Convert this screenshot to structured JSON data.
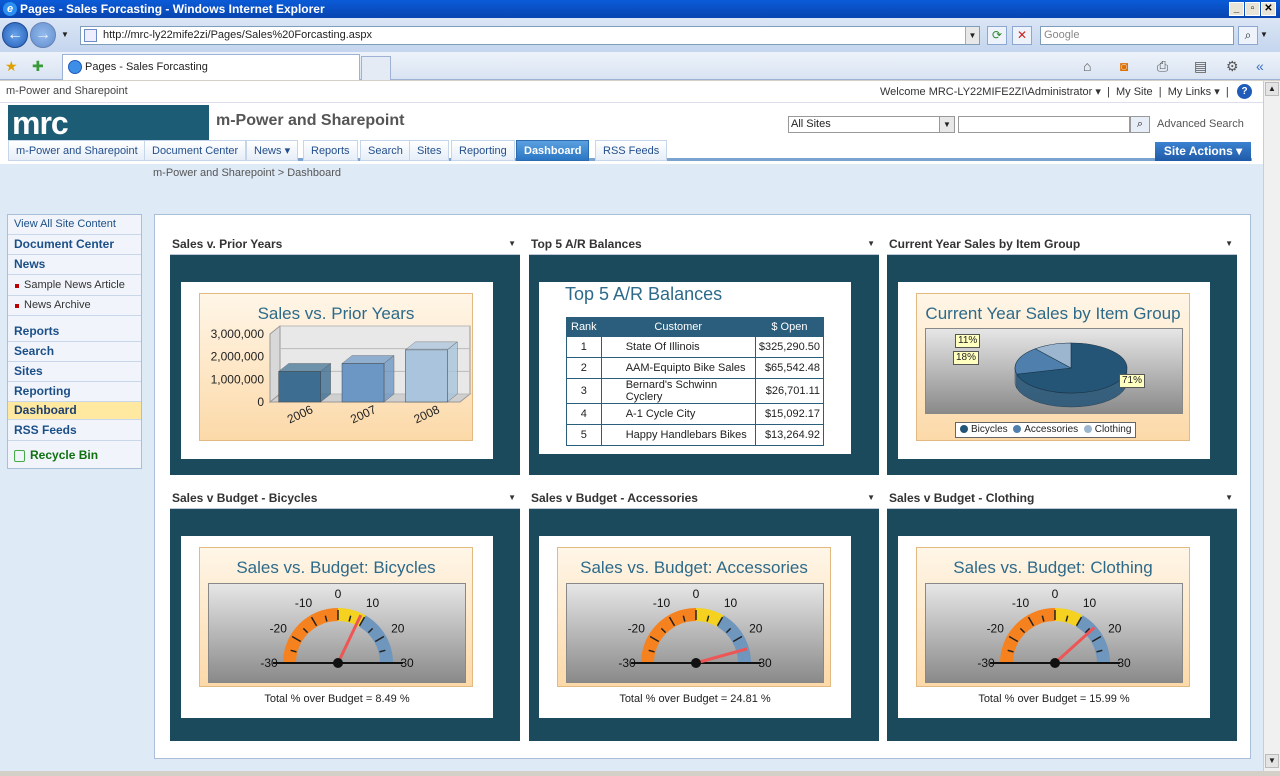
{
  "browser": {
    "window_title": "Pages - Sales Forcasting - Windows Internet Explorer",
    "url": "http://mrc-ly22mife2zi/Pages/Sales%20Forcasting.aspx",
    "search_placeholder": "Google",
    "tab_title": "Pages - Sales Forcasting"
  },
  "sp": {
    "site_link": "m-Power and Sharepoint",
    "welcome": "Welcome MRC-LY22MIFE2ZI\\Administrator",
    "my_site": "My Site",
    "my_links": "My Links",
    "logo": "mrc",
    "site_title": "m-Power and Sharepoint",
    "search_scope": "All Sites",
    "advanced_search": "Advanced Search",
    "site_actions": "Site Actions",
    "nav": [
      "m-Power and Sharepoint",
      "Document Center",
      "News",
      "Reports",
      "Search",
      "Sites",
      "Reporting",
      "Dashboard",
      "RSS Feeds"
    ],
    "breadcrumb": "m-Power and Sharepoint > Dashboard"
  },
  "quicklaunch": {
    "view_all": "View All Site Content",
    "document_center": "Document Center",
    "news": "News",
    "news_items": [
      "Sample News Article",
      "News Archive"
    ],
    "reports": "Reports",
    "search": "Search",
    "sites": "Sites",
    "reporting": "Reporting",
    "dashboard": "Dashboard",
    "rss": "RSS Feeds",
    "recycle": "Recycle Bin"
  },
  "webparts": {
    "wp1_title": "Sales v. Prior Years",
    "wp2_title": "Top 5 A/R Balances",
    "wp3_title": "Current Year Sales by Item Group",
    "wp4_title": "Sales v Budget - Bicycles",
    "wp5_title": "Sales v Budget - Accessories",
    "wp6_title": "Sales v Budget - Clothing"
  },
  "ar_table": {
    "title": "Top 5 A/R Balances",
    "headers": [
      "Rank",
      "Customer",
      "$ Open"
    ],
    "rows": [
      [
        "1",
        "State Of Illinois",
        "$325,290.50"
      ],
      [
        "2",
        "AAM-Equipto Bike Sales",
        "$65,542.48"
      ],
      [
        "3",
        "Bernard's Schwinn Cyclery",
        "$26,701.11"
      ],
      [
        "4",
        "A-1 Cycle City",
        "$15,092.17"
      ],
      [
        "5",
        "Happy Handlebars Bikes",
        "$13,264.92"
      ]
    ]
  },
  "chart_data": [
    {
      "type": "bar",
      "title": "Sales vs. Prior Years",
      "categories": [
        "2006",
        "2007",
        "2008"
      ],
      "values": [
        1350000,
        1700000,
        2300000
      ],
      "ylim": [
        0,
        3000000
      ],
      "yticks": [
        "3,000,000",
        "2,000,000",
        "1,000,000",
        "0"
      ],
      "colors": [
        "#3d6e92",
        "#6c97c4",
        "#a9c4dc"
      ]
    },
    {
      "type": "pie",
      "title": "Current Year Sales by Item Group",
      "categories": [
        "Bicycles",
        "Accessories",
        "Clothing"
      ],
      "values": [
        71,
        18,
        11
      ],
      "labels": [
        "71%",
        "18%",
        "11%"
      ],
      "colors": [
        "#245577",
        "#4f80ad",
        "#9bb6ce"
      ]
    },
    {
      "type": "gauge",
      "title": "Sales vs. Budget: Bicycles",
      "value": 8.49,
      "range": [
        -30,
        30
      ],
      "ticks": [
        "-30",
        "-20",
        "-10",
        "0",
        "10",
        "20",
        "30"
      ],
      "caption": "Total % over Budget = 8.49 %"
    },
    {
      "type": "gauge",
      "title": "Sales vs. Budget: Accessories",
      "value": 24.81,
      "range": [
        -30,
        30
      ],
      "ticks": [
        "-30",
        "-20",
        "-10",
        "0",
        "10",
        "20",
        "30"
      ],
      "caption": "Total % over Budget = 24.81 %"
    },
    {
      "type": "gauge",
      "title": "Sales vs. Budget: Clothing",
      "value": 15.99,
      "range": [
        -30,
        30
      ],
      "ticks": [
        "-30",
        "-20",
        "-10",
        "0",
        "10",
        "20",
        "30"
      ],
      "caption": "Total % over Budget = 15.99 %"
    }
  ]
}
